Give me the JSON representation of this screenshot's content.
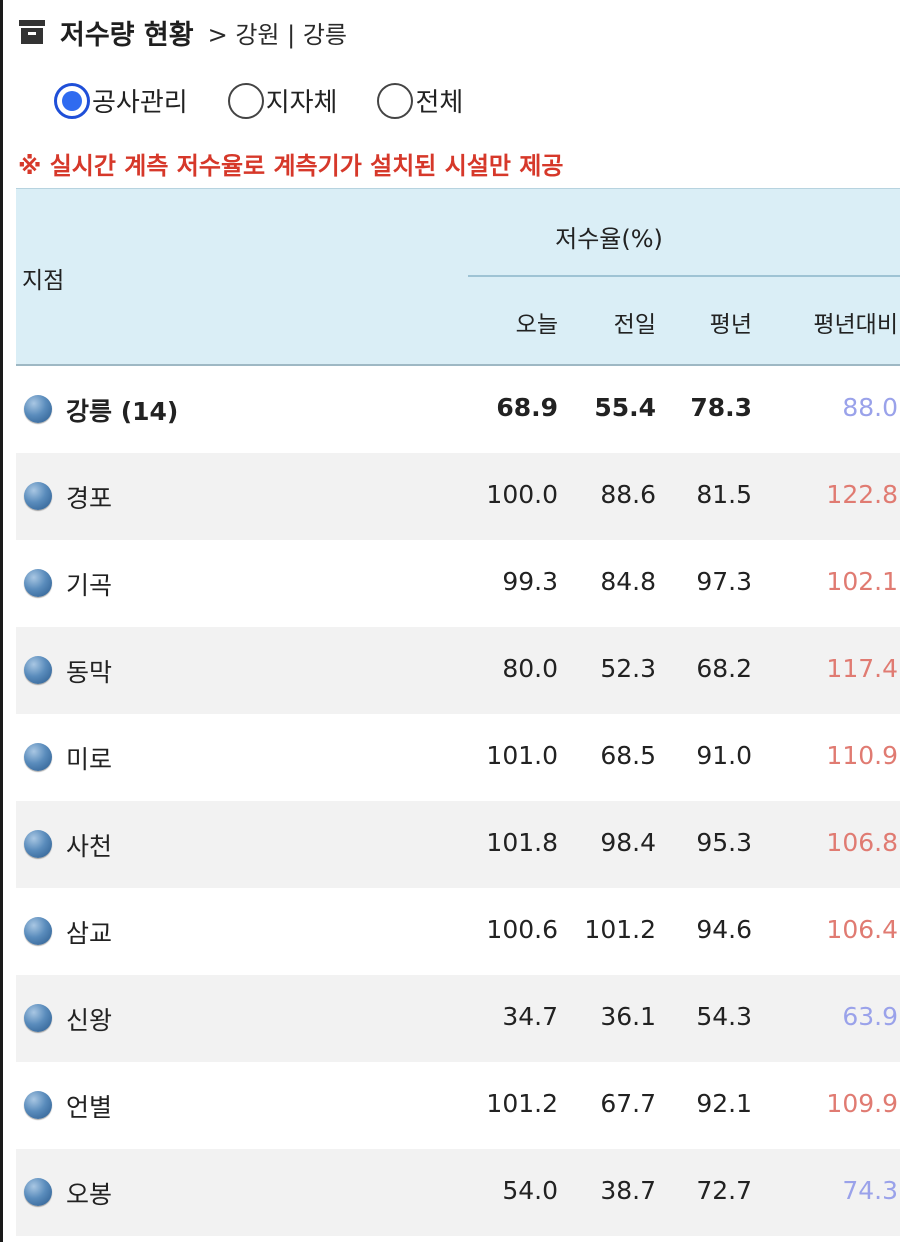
{
  "header": {
    "title": "저수량 현황",
    "breadcrumb": "> 강원 | 강릉",
    "icon": "archive-box-icon"
  },
  "filter": {
    "options": [
      {
        "label": "공사관리",
        "checked": true
      },
      {
        "label": "지자체",
        "checked": false
      },
      {
        "label": "전체",
        "checked": false
      }
    ]
  },
  "notice": "※ 실시간 계측 저수율로 계측기가 설치된 시설만 제공",
  "table": {
    "site_header": "지점",
    "group_header": "저수율(%)",
    "columns": [
      "오늘",
      "전일",
      "평년",
      "평년대비"
    ],
    "summary": {
      "site": "강릉 (14)",
      "today": "68.9",
      "prev": "55.4",
      "avg": "78.3",
      "ratio": "88.0"
    },
    "rows": [
      {
        "site": "경포",
        "today": "100.0",
        "prev": "88.6",
        "avg": "81.5",
        "ratio": "122.8"
      },
      {
        "site": "기곡",
        "today": "99.3",
        "prev": "84.8",
        "avg": "97.3",
        "ratio": "102.1"
      },
      {
        "site": "동막",
        "today": "80.0",
        "prev": "52.3",
        "avg": "68.2",
        "ratio": "117.4"
      },
      {
        "site": "미로",
        "today": "101.0",
        "prev": "68.5",
        "avg": "91.0",
        "ratio": "110.9"
      },
      {
        "site": "사천",
        "today": "101.8",
        "prev": "98.4",
        "avg": "95.3",
        "ratio": "106.8"
      },
      {
        "site": "삼교",
        "today": "100.6",
        "prev": "101.2",
        "avg": "94.6",
        "ratio": "106.4"
      },
      {
        "site": "신왕",
        "today": "34.7",
        "prev": "36.1",
        "avg": "54.3",
        "ratio": "63.9"
      },
      {
        "site": "언별",
        "today": "101.2",
        "prev": "67.7",
        "avg": "92.1",
        "ratio": "109.9"
      },
      {
        "site": "오봉",
        "today": "54.0",
        "prev": "38.7",
        "avg": "72.7",
        "ratio": "74.3"
      }
    ]
  },
  "colors": {
    "ratio_above": "#e07b72",
    "ratio_below": "#9aa2ea",
    "header_bg": "#daeef6",
    "notice": "#d6382a",
    "radio_selected": "#2f6bf0"
  }
}
